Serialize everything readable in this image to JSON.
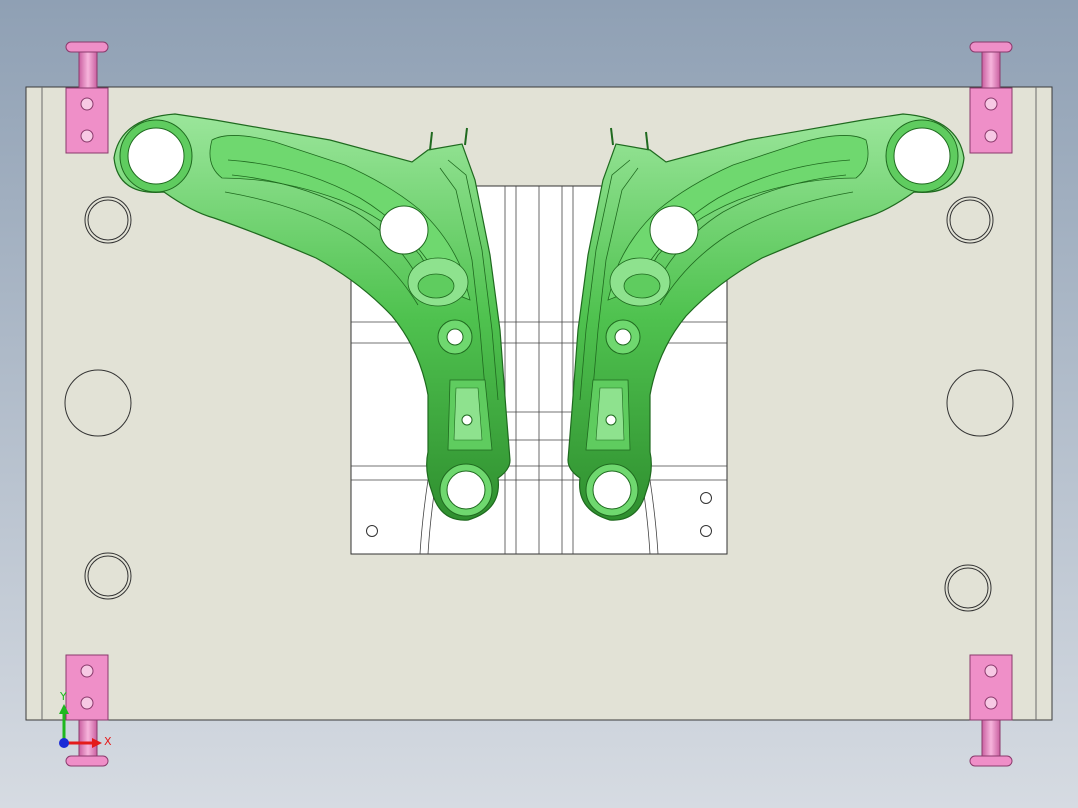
{
  "viewport": {
    "background_top": "#8fa0b4",
    "background_bottom": "#d6dbe2"
  },
  "colors": {
    "plate": "#e2e2d6",
    "plate_edge": "#3a3a3a",
    "part": "#4fc24f",
    "part_dark": "#1f6a1f",
    "part_light": "#9be69b",
    "insert": "#ffffff",
    "clamp": "#ef8fc8",
    "clamp_dark": "#b24e8d"
  },
  "triad": {
    "x_label": "X",
    "y_label": "Y",
    "x_color": "#e41b1b",
    "y_color": "#1fb81f",
    "z_color": "#1a2bd6"
  }
}
